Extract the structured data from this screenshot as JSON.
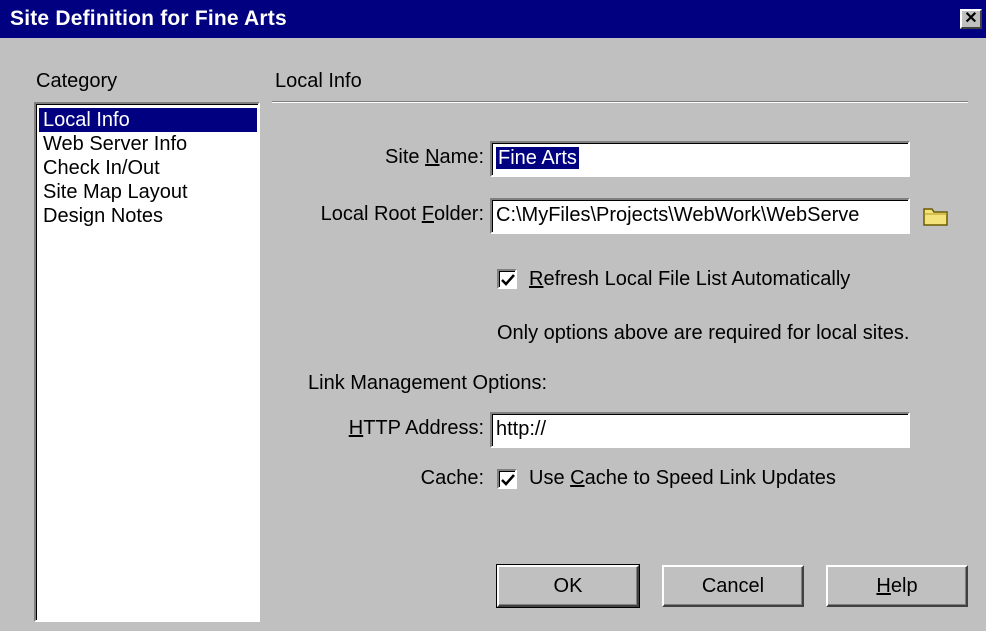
{
  "window": {
    "title": "Site Definition for Fine Arts",
    "close_glyph": "✕"
  },
  "category": {
    "heading": "Category",
    "items": [
      "Local Info",
      "Web Server Info",
      "Check In/Out",
      "Site Map Layout",
      "Design Notes"
    ],
    "selected": "Local Info"
  },
  "section": {
    "heading": "Local Info"
  },
  "form": {
    "site_name": {
      "label_pre": "Site ",
      "label_key": "N",
      "label_post": "ame:",
      "value": "Fine Arts"
    },
    "local_root": {
      "label_pre": "Local Root ",
      "label_key": "F",
      "label_post": "older:",
      "value": "C:\\MyFiles\\Projects\\WebWork\\WebServe",
      "browse_icon": "folder-icon"
    },
    "refresh": {
      "label_key": "R",
      "label_post": "efresh Local File List Automatically",
      "checked": true
    },
    "note": "Only options above are required for local sites.",
    "link_heading": "Link Management Options:",
    "http": {
      "label_key": "H",
      "label_post": "TTP Address:",
      "value": "http://"
    },
    "cache": {
      "label": "Cache:",
      "option_pre": "Use ",
      "option_key": "C",
      "option_post": "ache to Speed Link Updates",
      "checked": true
    }
  },
  "buttons": {
    "ok": "OK",
    "cancel": "Cancel",
    "help_key": "H",
    "help_post": "elp"
  },
  "colors": {
    "titlebar": "#000080",
    "face": "#c0c0c0",
    "selection": "#000080",
    "folder": "#f4e27a"
  }
}
